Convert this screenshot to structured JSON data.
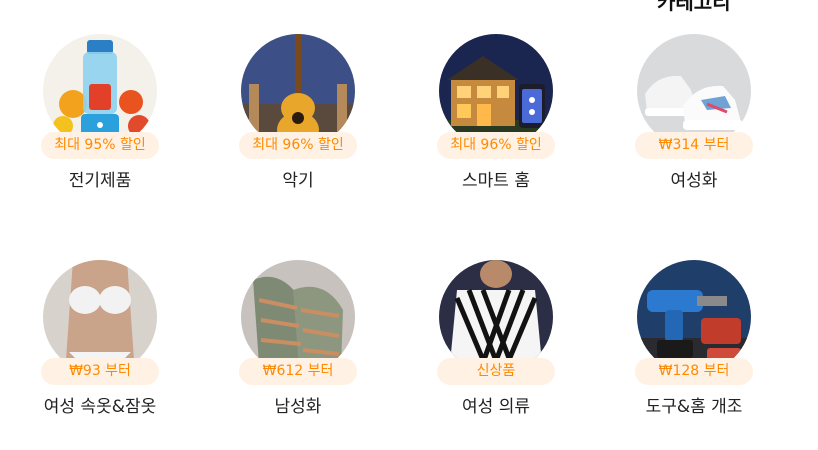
{
  "header_partial": "카테고리",
  "categories": [
    {
      "label": "전기제품",
      "badge": "최대 95% 할인",
      "image": "blender-icon"
    },
    {
      "label": "악기",
      "badge": "최대 96% 할인",
      "image": "guitar-icon"
    },
    {
      "label": "스마트 홈",
      "badge": "최대 96% 할인",
      "image": "smart-house-icon"
    },
    {
      "label": "여성화",
      "badge": "₩314 부터",
      "image": "sneaker-icon"
    },
    {
      "label": "여성 속옷&잠옷",
      "badge": "₩93 부터",
      "image": "lingerie-icon"
    },
    {
      "label": "남성화",
      "badge": "₩612 부터",
      "image": "mens-shoes-icon"
    },
    {
      "label": "여성 의류",
      "badge": "신상품",
      "image": "striped-blouse-icon"
    },
    {
      "label": "도구&홈 개조",
      "badge": "₩128 부터",
      "image": "power-drill-icon"
    }
  ],
  "colors": {
    "badge_bg": "#fff1e3",
    "badge_text": "#ff8a00"
  }
}
